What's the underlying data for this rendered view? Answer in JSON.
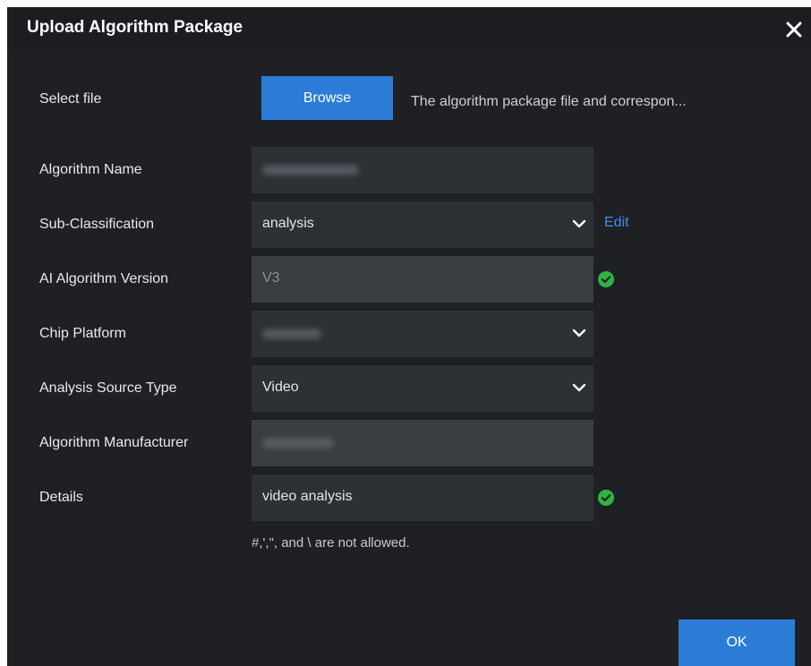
{
  "dialog": {
    "title": "Upload Algorithm Package",
    "close_icon": "close-icon"
  },
  "form": {
    "select_file": {
      "label": "Select file",
      "button_label": "Browse",
      "hint": "The algorithm package file and correspon..."
    },
    "algorithm_name": {
      "label": "Algorithm Name",
      "value": "[blurred]"
    },
    "sub_classification": {
      "label": "Sub-Classification",
      "value": "analysis",
      "edit_label": "Edit"
    },
    "ai_algorithm_version": {
      "label": "AI Algorithm Version",
      "value": "V3",
      "status_icon": "check-circle-icon"
    },
    "chip_platform": {
      "label": "Chip Platform",
      "value": "[blurred]"
    },
    "analysis_source_type": {
      "label": "Analysis Source Type",
      "value": "Video"
    },
    "algorithm_manufacturer": {
      "label": "Algorithm Manufacturer",
      "value": "[blurred]"
    },
    "details": {
      "label": "Details",
      "value": "video analysis",
      "status_icon": "check-circle-icon",
      "note": "#,',\", and \\ are not allowed."
    }
  },
  "footer": {
    "ok_label": "OK"
  },
  "colors": {
    "accent": "#2c7cd8",
    "link": "#3d8ef0",
    "success": "#2fb344",
    "background": "#1e2024",
    "field": "#2d3035"
  }
}
